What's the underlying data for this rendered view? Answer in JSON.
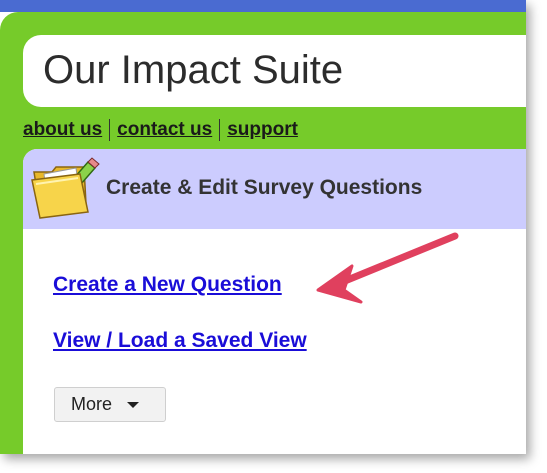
{
  "app": {
    "title": "Our Impact Suite"
  },
  "top_nav": {
    "items": [
      {
        "label": "about us"
      },
      {
        "label": "contact us"
      },
      {
        "label": "support"
      }
    ]
  },
  "panel": {
    "title": "Create & Edit Survey Questions",
    "icon": "folder-pencil-icon"
  },
  "actions": {
    "create_question": "Create a New Question",
    "view_saved": "View / Load a Saved View"
  },
  "more_button": {
    "label": "More",
    "icon": "caret-down-icon"
  },
  "colors": {
    "header_green": "#76cb2a",
    "top_strip_blue": "#4a6bd1",
    "panel_header_lavender": "#ccccfe",
    "link_blue": "#1a0dd8",
    "annotation_arrow": "#e0405e"
  }
}
